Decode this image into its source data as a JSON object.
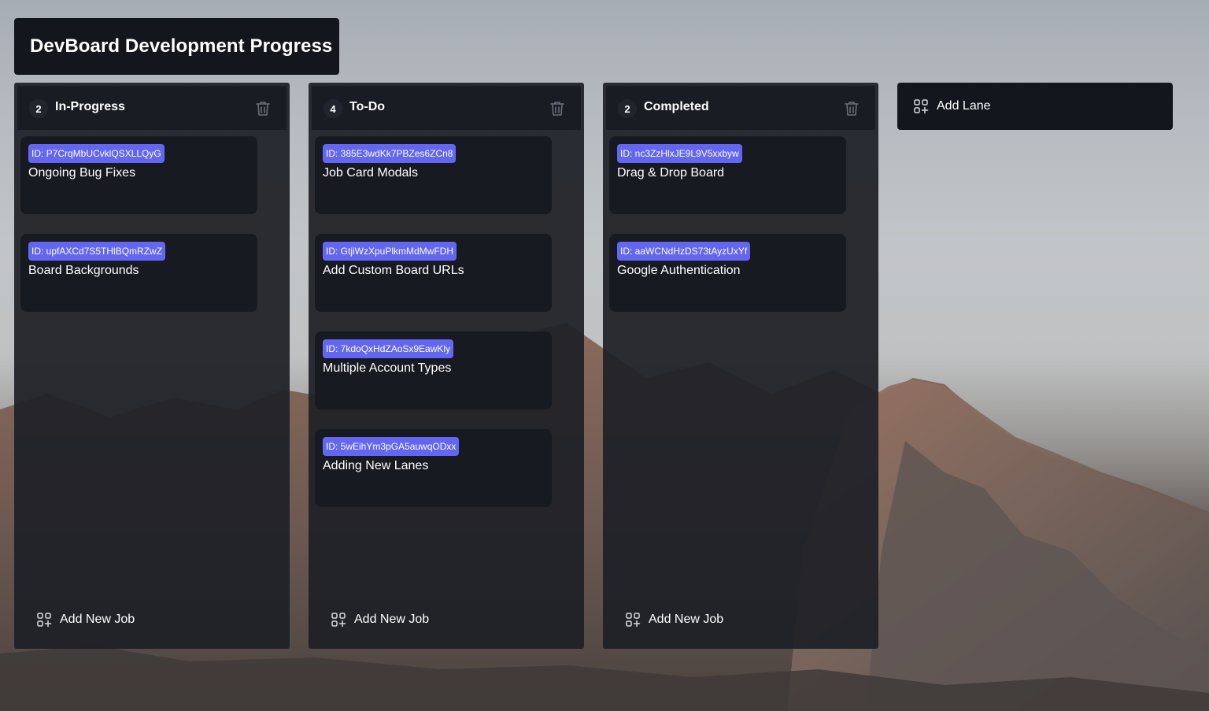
{
  "board": {
    "title": "DevBoard Development Progress"
  },
  "lanes": [
    {
      "count": "2",
      "title": "In-Progress",
      "add_job_label": "Add New Job",
      "cards": [
        {
          "id": "ID: P7CrqMbUCvklQSXLLQyG",
          "title": "Ongoing Bug Fixes"
        },
        {
          "id": "ID: upfAXCd7S5THlBQmRZwZ",
          "title": "Board Backgrounds"
        }
      ]
    },
    {
      "count": "4",
      "title": "To-Do",
      "add_job_label": "Add New Job",
      "cards": [
        {
          "id": "ID: 385E3wdKk7PBZes6ZCn8",
          "title": "Job Card Modals"
        },
        {
          "id": "ID: GtjiWzXpuPlkmMdMwFDH",
          "title": "Add Custom Board URLs"
        },
        {
          "id": "ID: 7kdoQxHdZAoSx9EawKly",
          "title": "Multiple Account Types"
        },
        {
          "id": "ID: 5wEihYm3pGA5auwqODxx",
          "title": "Adding New Lanes"
        }
      ]
    },
    {
      "count": "2",
      "title": "Completed",
      "add_job_label": "Add New Job",
      "cards": [
        {
          "id": "ID: nc3ZzHlxJE9L9V5xxbyw",
          "title": "Drag & Drop Board"
        },
        {
          "id": "ID: aaWCNdHzDS73tAyzUxYf",
          "title": "Google Authentication"
        }
      ]
    }
  ],
  "add_lane": {
    "label": "Add Lane"
  },
  "colors": {
    "id_badge": "#6366f1",
    "lane_bg": "#1e2027",
    "card_bg": "#181a21",
    "title_bg": "#14161d"
  },
  "icons": {
    "delete": "trash-icon",
    "add": "grid-plus-icon"
  }
}
